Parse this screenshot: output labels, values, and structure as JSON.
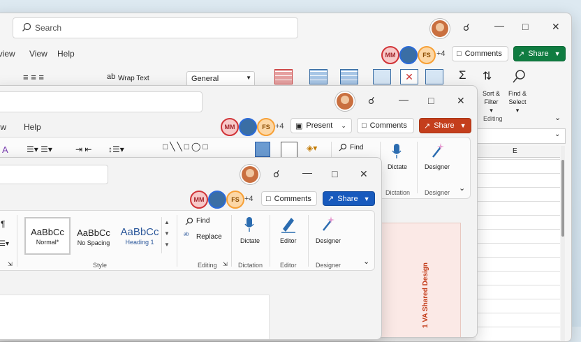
{
  "excel": {
    "search_placeholder": "Search",
    "tabs": [
      "eview",
      "View",
      "Help"
    ],
    "wrap_text": "Wrap Text",
    "number_format": "General",
    "comments": "Comments",
    "share": "Share",
    "sort_filter": "Sort &\nFilter",
    "find_select": "Find &\nSelect",
    "editing": "Editing",
    "collaborators": {
      "mm": "MM",
      "fs": "FS",
      "more": "+4"
    },
    "column_e": "E"
  },
  "powerpoint": {
    "tabs": [
      "iew",
      "Help"
    ],
    "present": "Present",
    "comments": "Comments",
    "share": "Share",
    "find": "Find",
    "dictate": "Dictate",
    "dictation": "Dictation",
    "designer": "Designer",
    "designer_group": "Designer",
    "collaborators": {
      "mm": "MM",
      "fs": "FS",
      "more": "+4"
    },
    "slide_text": "1   VA Shared Design"
  },
  "word": {
    "comments": "Comments",
    "share": "Share",
    "collaborators": {
      "mm": "MM",
      "fs": "FS",
      "more": "+4"
    },
    "styles": [
      {
        "sample": "AaBbCc",
        "name": "Normal*"
      },
      {
        "sample": "AaBbCc",
        "name": "No Spacing"
      },
      {
        "sample": "AaBbCc",
        "name": "Heading 1"
      }
    ],
    "find": "Find",
    "replace": "Replace",
    "dictate": "Dictate",
    "editor": "Editor",
    "designer": "Designer",
    "groups": {
      "style": "Style",
      "editing": "Editing",
      "dictation": "Dictation",
      "editor": "Editor",
      "designer": "Designer"
    }
  },
  "colors": {
    "excel_green": "#107c41",
    "ppt_red": "#c43e1c",
    "word_blue": "#185abd"
  }
}
